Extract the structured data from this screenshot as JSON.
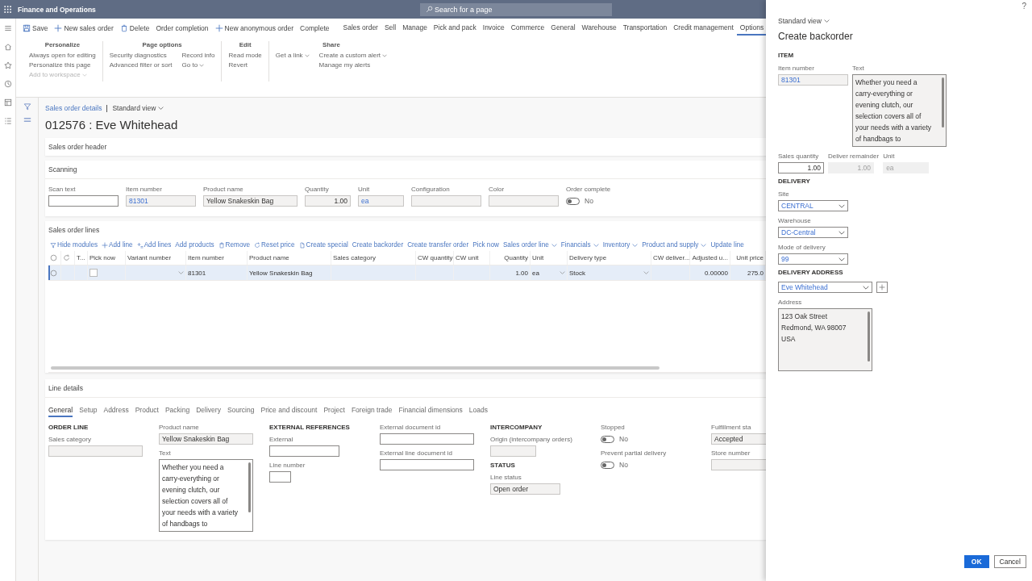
{
  "app": {
    "title": "Finance and Operations",
    "search_placeholder": "Search for a page"
  },
  "action_pane": {
    "buttons": [
      {
        "label": "Save"
      },
      {
        "label": "New sales order"
      },
      {
        "label": "Delete"
      },
      {
        "label": "Order completion"
      },
      {
        "label": "New anonymous order"
      },
      {
        "label": "Complete"
      }
    ],
    "tabs": [
      {
        "label": "Sales order",
        "selected": false
      },
      {
        "label": "Sell",
        "selected": false
      },
      {
        "label": "Manage",
        "selected": false
      },
      {
        "label": "Pick and pack",
        "selected": false
      },
      {
        "label": "Invoice",
        "selected": false
      },
      {
        "label": "Commerce",
        "selected": false
      },
      {
        "label": "General",
        "selected": false
      },
      {
        "label": "Warehouse",
        "selected": false
      },
      {
        "label": "Transportation",
        "selected": false
      },
      {
        "label": "Credit management",
        "selected": false
      },
      {
        "label": "Options",
        "selected": true
      }
    ],
    "groups": [
      {
        "title": "Personalize",
        "columns": [
          [
            {
              "label": "Always open for editing",
              "disabled": false,
              "dropdown": false
            },
            {
              "label": "Personalize this page",
              "disabled": false,
              "dropdown": false
            },
            {
              "label": "Add to workspace",
              "disabled": true,
              "dropdown": true
            }
          ]
        ]
      },
      {
        "title": "Page options",
        "columns": [
          [
            {
              "label": "Security diagnostics",
              "disabled": false,
              "dropdown": false
            },
            {
              "label": "Advanced filter or sort",
              "disabled": false,
              "dropdown": false
            }
          ],
          [
            {
              "label": "Record info",
              "disabled": false,
              "dropdown": false
            },
            {
              "label": "Go to",
              "disabled": false,
              "dropdown": true
            }
          ]
        ]
      },
      {
        "title": "Edit",
        "columns": [
          [
            {
              "label": "Read mode",
              "disabled": false,
              "dropdown": false
            },
            {
              "label": "Revert",
              "disabled": false,
              "dropdown": false
            }
          ]
        ]
      },
      {
        "title": "Share",
        "columns": [
          [
            {
              "label": "Get a link",
              "disabled": false,
              "dropdown": true
            }
          ],
          [
            {
              "label": "Create a custom alert",
              "disabled": false,
              "dropdown": true
            },
            {
              "label": "Manage my alerts",
              "disabled": false,
              "dropdown": false
            }
          ]
        ]
      }
    ]
  },
  "breadcrumb": {
    "link": "Sales order details",
    "view": "Standard view"
  },
  "title": "012576 : Eve Whitehead",
  "header_section": {
    "title": "Sales order header"
  },
  "scanning": {
    "title": "Scanning",
    "fields": [
      {
        "label": "Scan text",
        "kind": "input"
      },
      {
        "label": "Item number",
        "kind": "readonly",
        "value": "81301",
        "link": true
      },
      {
        "label": "Product name",
        "kind": "readonly",
        "value": "Yellow Snakeskin Bag"
      },
      {
        "label": "Quantity",
        "kind": "readonly",
        "value": "1.00",
        "numeric": true
      },
      {
        "label": "Unit",
        "kind": "readonly",
        "value": "ea",
        "link": true
      },
      {
        "label": "Configuration",
        "kind": "readonly"
      },
      {
        "label": "Color",
        "kind": "readonly"
      },
      {
        "label": "Order complete",
        "kind": "toggle",
        "on": false,
        "value": "No"
      }
    ]
  },
  "lines": {
    "title": "Sales order lines",
    "toolbar": [
      {
        "label": "Hide modules",
        "dropdown": false
      },
      {
        "label": "Add line",
        "dropdown": false
      },
      {
        "label": "Add lines",
        "dropdown": false
      },
      {
        "label": "Add products",
        "dropdown": false
      },
      {
        "label": "Remove",
        "dropdown": false
      },
      {
        "label": "Reset price",
        "dropdown": false
      },
      {
        "label": "Create special",
        "dropdown": false
      },
      {
        "label": "Create backorder",
        "dropdown": false
      },
      {
        "label": "Create transfer order",
        "dropdown": false
      },
      {
        "label": "Pick now",
        "dropdown": false
      },
      {
        "label": "Sales order line",
        "dropdown": true
      },
      {
        "label": "Financials",
        "dropdown": true
      },
      {
        "label": "Inventory",
        "dropdown": true
      },
      {
        "label": "Product and supply",
        "dropdown": true
      },
      {
        "label": "Update line",
        "dropdown": false
      }
    ],
    "columns": [
      {
        "kind": "select"
      },
      {
        "kind": "refresh"
      },
      {
        "kind": "text",
        "label": "T..."
      },
      {
        "kind": "check",
        "label": "Pick now"
      },
      {
        "kind": "dropdown",
        "label": "Variant number"
      },
      {
        "kind": "text",
        "label": "Item number"
      },
      {
        "kind": "text",
        "label": "Product name"
      },
      {
        "kind": "text",
        "label": "Sales category"
      },
      {
        "kind": "text",
        "label": "CW quantity"
      },
      {
        "kind": "text",
        "label": "CW unit"
      },
      {
        "kind": "number",
        "label": "Quantity"
      },
      {
        "kind": "dropdown",
        "label": "Unit"
      },
      {
        "kind": "dropdown",
        "label": "Delivery type"
      },
      {
        "kind": "text",
        "label": "CW deliver..."
      },
      {
        "kind": "number",
        "label": "Adjusted u..."
      },
      {
        "kind": "number",
        "label": "Unit price"
      }
    ],
    "rows": [
      {
        "selected": true,
        "pick_now": false,
        "item_number": "81301",
        "product_name": "Yellow Snakeskin Bag",
        "quantity": "1.00",
        "unit": "ea",
        "delivery_type": "Stock",
        "adjusted_unit_price": "0.00000",
        "unit_price": "275.0"
      }
    ]
  },
  "line_details": {
    "title": "Line details",
    "tabs": [
      {
        "label": "General",
        "selected": true
      },
      {
        "label": "Setup",
        "selected": false
      },
      {
        "label": "Address",
        "selected": false
      },
      {
        "label": "Product",
        "selected": false
      },
      {
        "label": "Packing",
        "selected": false
      },
      {
        "label": "Delivery",
        "selected": false
      },
      {
        "label": "Sourcing",
        "selected": false
      },
      {
        "label": "Price and discount",
        "selected": false
      },
      {
        "label": "Project",
        "selected": false
      },
      {
        "label": "Foreign trade",
        "selected": false
      },
      {
        "label": "Financial dimensions",
        "selected": false
      },
      {
        "label": "Loads",
        "selected": false
      }
    ],
    "columns": [
      [
        {
          "kind": "heading",
          "label": "ORDER LINE"
        },
        {
          "label": "Sales category",
          "kind": "readonly"
        }
      ],
      [
        {
          "label": "Product name",
          "kind": "readonly",
          "value": "Yellow Snakeskin Bag"
        },
        {
          "label": "Text",
          "kind": "textarea",
          "value": "Whether you need a carry-everything or evening clutch, our selection covers all of your needs with a variety of handbags to"
        }
      ],
      [
        {
          "kind": "heading",
          "label": "EXTERNAL REFERENCES"
        },
        {
          "label": "External",
          "kind": "input"
        },
        {
          "label": "Line number",
          "kind": "input"
        }
      ],
      [
        {
          "label": "External document id",
          "kind": "input"
        },
        {
          "label": "External line document id",
          "kind": "input"
        }
      ],
      [
        {
          "kind": "heading",
          "label": "INTERCOMPANY"
        },
        {
          "label": "Origin (intercompany orders)",
          "kind": "readonly"
        },
        {
          "kind": "heading",
          "label": "STATUS"
        },
        {
          "label": "Line status",
          "kind": "readonly",
          "value": "Open order"
        }
      ],
      [
        {
          "label": "Stopped",
          "kind": "toggle",
          "on": false,
          "value": "No"
        },
        {
          "label": "Prevent partial delivery",
          "kind": "toggle",
          "on": false,
          "value": "No"
        }
      ],
      [
        {
          "label": "Fulfillment sta",
          "kind": "readonly",
          "value": "Accepted"
        },
        {
          "label": "Store number",
          "kind": "readonly"
        }
      ]
    ]
  },
  "panel": {
    "help": "?",
    "view": "Standard view",
    "title": "Create backorder",
    "sections": [
      {
        "heading": "ITEM",
        "rows": [
          [
            {
              "label": "Item number",
              "kind": "readonly",
              "value": "81301",
              "link": true
            },
            {
              "label": "Text",
              "kind": "textarea-readonly",
              "value": "Whether you need a carry-everything or evening clutch, our selection covers all of your needs with a variety of handbags to"
            }
          ],
          [
            {
              "label": "Sales quantity",
              "kind": "input",
              "value": "1.00",
              "numeric": true
            },
            {
              "label": "Deliver remainder",
              "kind": "disabled",
              "value": "1.00",
              "numeric": true
            },
            {
              "label": "Unit",
              "kind": "disabled",
              "value": "ea"
            }
          ]
        ]
      },
      {
        "heading": "DELIVERY",
        "rows": [
          [
            {
              "label": "Site",
              "kind": "dropdown",
              "value": "CENTRAL",
              "link": true
            }
          ],
          [
            {
              "label": "Warehouse",
              "kind": "dropdown",
              "value": "DC-Central",
              "link": true
            }
          ],
          [
            {
              "label": "Mode of delivery",
              "kind": "dropdown",
              "value": "99",
              "link": true
            }
          ]
        ]
      },
      {
        "heading": "DELIVERY ADDRESS",
        "rows": [
          [
            {
              "kind": "dropdown",
              "value": "Eve Whitehead",
              "link": true
            },
            {
              "kind": "add"
            }
          ],
          [
            {
              "label": "Address",
              "kind": "textarea-readonly",
              "value": "123 Oak Street\nRedmond, WA 98007\nUSA"
            }
          ]
        ]
      }
    ],
    "buttons": [
      {
        "label": "OK",
        "primary": true
      },
      {
        "label": "Cancel",
        "primary": false
      }
    ]
  }
}
